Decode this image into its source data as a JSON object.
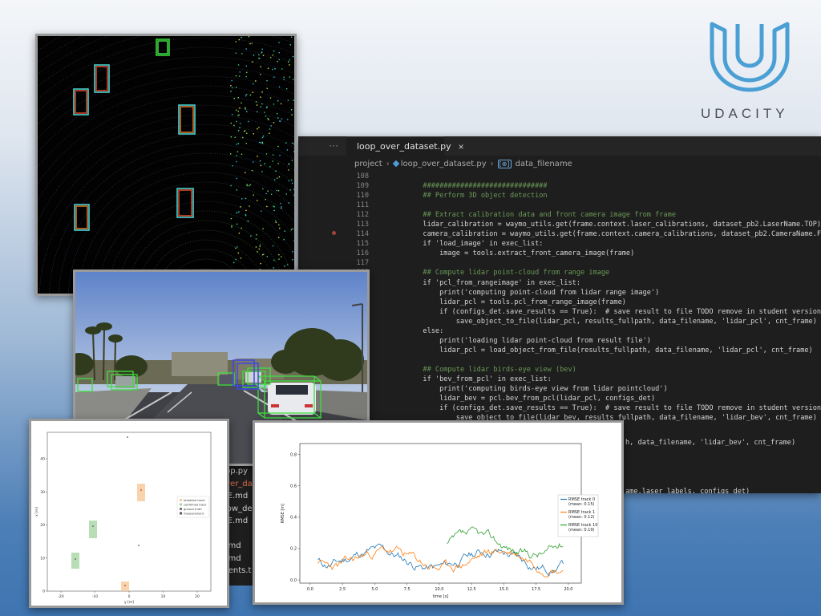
{
  "logo": {
    "wordmark": "UDACITY",
    "color": "#4a9fd4"
  },
  "editor": {
    "more_icon": "···",
    "tab_label": "loop_over_dataset.py",
    "tab_close": "×",
    "breadcrumb": {
      "folder": "project",
      "file": "loop_over_dataset.py",
      "symbol_icon": "[⊕]",
      "symbol": "data_filename"
    },
    "lines": [
      {
        "n": "108",
        "t": ""
      },
      {
        "n": "109",
        "t": "        ##############################"
      },
      {
        "n": "110",
        "t": "        ## Perform 3D object detection"
      },
      {
        "n": "111",
        "t": ""
      },
      {
        "n": "112",
        "t": "        ## Extract calibration data and front camera image from frame"
      },
      {
        "n": "113",
        "t": "        lidar_calibration = waymo_utils.get(frame.context.laser_calibrations, dataset_pb2.LaserName.TOP)"
      },
      {
        "n": "114",
        "t": "        camera_calibration = waymo_utils.get(frame.context.camera_calibrations, dataset_pb2.CameraName.FRONT)"
      },
      {
        "n": "115",
        "t": "        if 'load_image' in exec_list:"
      },
      {
        "n": "116",
        "t": "            image = tools.extract_front_camera_image(frame)"
      },
      {
        "n": "117",
        "t": ""
      },
      {
        "n": "118",
        "t": "        ## Compute lidar point-cloud from range image"
      },
      {
        "n": "",
        "t": "        if 'pcl_from_rangeimage' in exec_list:"
      },
      {
        "n": "",
        "t": "            print('computing point-cloud from lidar range image')"
      },
      {
        "n": "",
        "t": "            lidar_pcl = tools.pcl_from_range_image(frame)"
      },
      {
        "n": "",
        "t": "            if (configs_det.save_results == True):  # save result to file TODO remove in student version"
      },
      {
        "n": "",
        "t": "                save_object_to_file(lidar_pcl, results_fullpath, data_filename, 'lidar_pcl', cnt_frame)"
      },
      {
        "n": "",
        "t": "        else:"
      },
      {
        "n": "",
        "t": "            print('loading lidar point-cloud from result file')"
      },
      {
        "n": "",
        "t": "            lidar_pcl = load_object_from_file(results_fullpath, data_filename, 'lidar_pcl', cnt_frame)"
      },
      {
        "n": "",
        "t": ""
      },
      {
        "n": "",
        "t": "        ## Compute lidar birds-eye view (bev)"
      },
      {
        "n": "",
        "t": "        if 'bev_from_pcl' in exec_list:"
      },
      {
        "n": "",
        "t": "            print('computing birds-eye view from lidar pointcloud')"
      },
      {
        "n": "",
        "t": "            lidar_bev = pcl.bev_from_pcl(lidar_pcl, configs_det)"
      },
      {
        "n": "",
        "t": "            if (configs_det.save_results == True):  # save result to file TODO remove in student version"
      },
      {
        "n": "",
        "t": "                save_object_to_file(lidar_bev, results_fullpath, data_filename, 'lidar_bev', cnt_frame)"
      }
    ],
    "partial_lines": [
      {
        "t": "h, data_filename, 'lidar_bev', cnt_frame)"
      },
      {
        "t": "ame.laser_labels, configs_det)"
      }
    ],
    "files": [
      {
        "name": "oop.py",
        "highlight": false
      },
      {
        "name": "over_dat",
        "highlight": true
      },
      {
        "name": "ME.md",
        "highlight": false
      },
      {
        "name": "_low_de",
        "highlight": false
      },
      {
        "name": "ME.md",
        "highlight": false
      },
      {
        "name": "e",
        "highlight": false
      },
      {
        "name": "E.md",
        "highlight": false
      },
      {
        "name": "E.md",
        "highlight": false
      },
      {
        "name": "ments.t",
        "highlight": false
      }
    ]
  },
  "scatter_plot": {
    "xlabel": "y [m]",
    "ylabel": "x [m]",
    "xticks": [
      "-20",
      "-10",
      "0",
      "10",
      "20"
    ],
    "yticks": [
      "0",
      "10",
      "20",
      "30",
      "40"
    ],
    "legend": [
      "tentative track",
      "confirmed track",
      "ground truth",
      "measurement"
    ],
    "colors": {
      "tentative": "#f6c89a",
      "confirmed": "#a8d5a2"
    }
  },
  "rmse_plot": {
    "xlabel": "time [s]",
    "ylabel": "RMSE [m]",
    "xticks": [
      "0.0",
      "2.5",
      "5.0",
      "7.5",
      "10.0",
      "12.5",
      "15.0",
      "17.5",
      "20.0"
    ],
    "yticks": [
      "0.0",
      "0.2",
      "0.4",
      "0.6",
      "0.8"
    ],
    "legend": [
      {
        "label": "RMSE track 0",
        "mean": "(mean: 0.15)",
        "color": "#1f77b4"
      },
      {
        "label": "RMSE track 1",
        "mean": "(mean: 0.12)",
        "color": "#ff7f0e"
      },
      {
        "label": "RMSE track 10",
        "mean": "(mean: 0.19)",
        "color": "#2ca02c"
      }
    ]
  }
}
